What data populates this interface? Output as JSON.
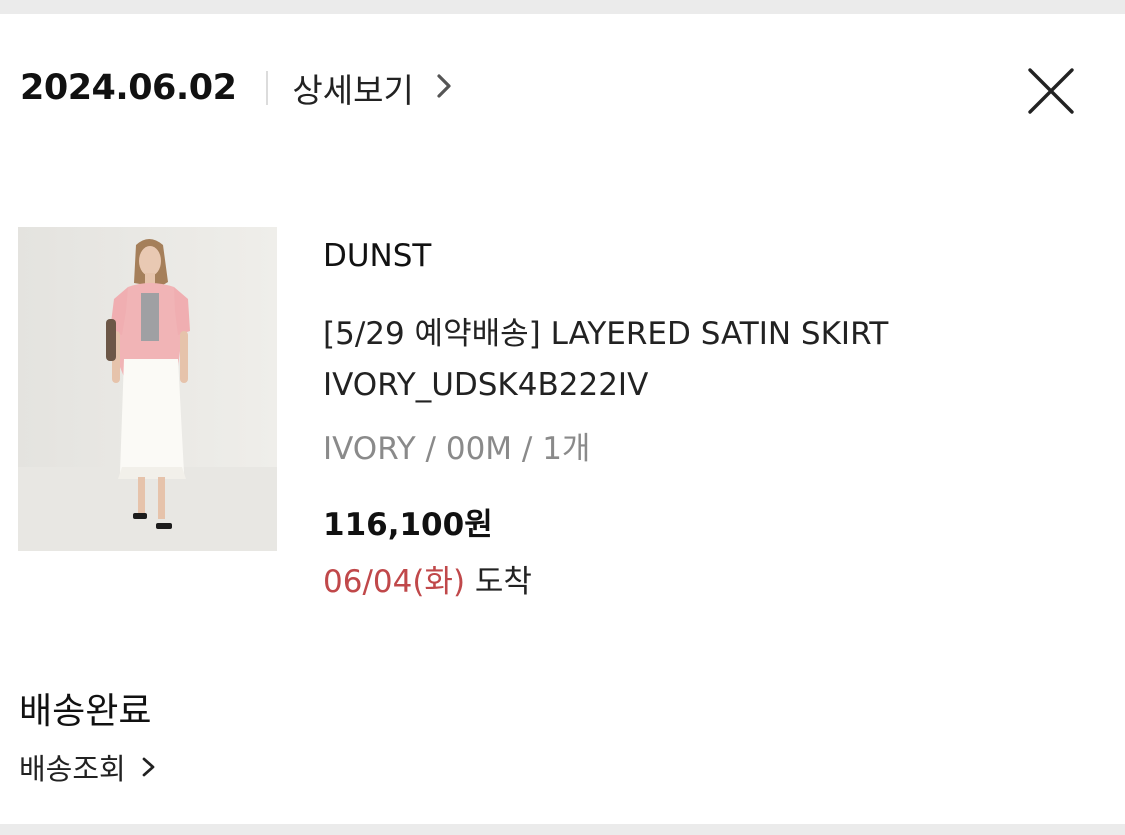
{
  "order": {
    "date": "2024.06.02",
    "detail_label": "상세보기"
  },
  "product": {
    "brand": "DUNST",
    "name": "[5/29 예약배송] LAYERED SATIN SKIRT IVORY_UDSK4B222IV",
    "options": "IVORY / 00M / 1개",
    "price": "116,100원",
    "arrival_date": "06/04(화)",
    "arrival_suffix": " 도착"
  },
  "delivery": {
    "status": "배송완료",
    "track_label": "배송조회"
  },
  "icons": {
    "close": "close-icon",
    "chevron": "chevron-right-icon"
  },
  "colors": {
    "arrival_accent": "#c0484a",
    "muted_text": "#8a8a8a"
  }
}
